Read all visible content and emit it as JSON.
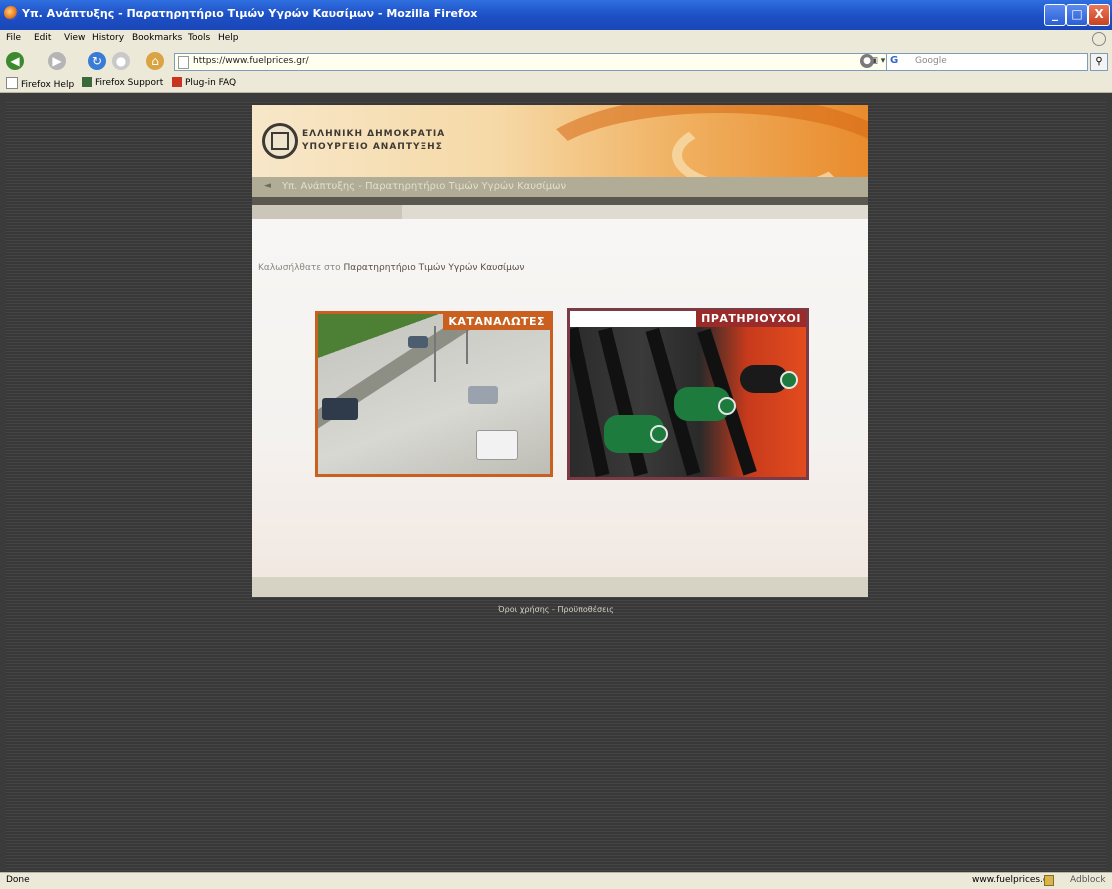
{
  "window": {
    "title": "Υπ. Ανάπτυξης - Παρατηρητήριο Τιμών Υγρών Καυσίμων - Mozilla Firefox",
    "controls": [
      "_",
      "□",
      "X"
    ]
  },
  "menu": [
    "File",
    "Edit",
    "View",
    "History",
    "Bookmarks",
    "Tools",
    "Help"
  ],
  "nav": {
    "url": "https://www.fuelprices.gr/",
    "search_engine": "G",
    "search_placeholder": "Google"
  },
  "bookmarks": [
    "Firefox Help",
    "Firefox Support",
    "Plug-in FAQ"
  ],
  "site": {
    "gov_line1": "ΕΛΛΗΝΙΚΗ ΔΗΜΟΚΡΑΤΙΑ",
    "gov_line2": "ΥΠΟΥΡΓΕΙΟ ΑΝΑΠΤΥΞΗΣ",
    "ministry_bar": "Υπ. Ανάπτυξης - Παρατηρητήριο Τιμών Υγρών Καυσίμων",
    "welcome_prefix": "Καλωσήλθατε στο ",
    "welcome_emph": "Παρατηρητήριο Τιμών Υγρών Καυσίμων",
    "card_consumers": "ΚΑΤΑΝΑΛΩΤΕΣ",
    "card_stations": "ΠΡΑΤΗΡΙΟΥΧΟΙ",
    "footer_link": "Όροι χρήσης - Προϋποθέσεις"
  },
  "status": {
    "text": "Done",
    "domain": "www.fuelprices.gr",
    "addon": "Adblock"
  },
  "colors": {
    "consumers_border": "#c9601f",
    "stations_border": "#7a3a46",
    "titlebar": "#1c4fc4"
  }
}
